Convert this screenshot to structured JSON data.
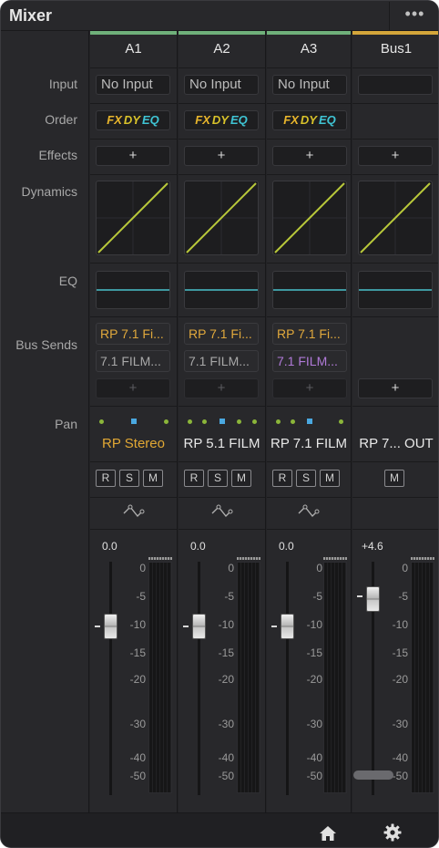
{
  "window": {
    "title": "Mixer",
    "menu_icon": "more-dots-icon"
  },
  "row_labels": {
    "input": "Input",
    "order": "Order",
    "effects": "Effects",
    "dynamics": "Dynamics",
    "eq": "EQ",
    "bus_sends": "Bus Sends",
    "pan": "Pan"
  },
  "strips": [
    {
      "name": "A1",
      "color": "#6fb07a",
      "input": "No Input",
      "order": [
        "FX",
        "DY",
        "EQ"
      ],
      "effects_add": "+",
      "sends": [
        "RP 7.1 Fi...",
        "7.1 FILM..."
      ],
      "send_add": "+",
      "output": "RP Stereo",
      "output_color": "#e2a834",
      "rsm": [
        "R",
        "S",
        "M"
      ],
      "fader_db": "0.0"
    },
    {
      "name": "A2",
      "color": "#6fb07a",
      "input": "No Input",
      "order": [
        "FX",
        "DY",
        "EQ"
      ],
      "effects_add": "+",
      "sends": [
        "RP 7.1 Fi...",
        "7.1 FILM..."
      ],
      "send_add": "+",
      "output": "RP 5.1 FILM",
      "output_color": "#e8e8e8",
      "rsm": [
        "R",
        "S",
        "M"
      ],
      "fader_db": "0.0"
    },
    {
      "name": "A3",
      "color": "#6fb07a",
      "input": "No Input",
      "order": [
        "FX",
        "DY",
        "EQ"
      ],
      "effects_add": "+",
      "sends": [
        "RP 7.1 Fi...",
        "7.1 FILM..."
      ],
      "send_add": "+",
      "output": "RP 7.1 FILM",
      "output_color": "#e8e8e8",
      "rsm": [
        "R",
        "S",
        "M"
      ],
      "fader_db": "0.0"
    },
    {
      "name": "Bus1",
      "color": "#d4a63a",
      "input": "",
      "effects_add": "+",
      "send_add": "+",
      "output": "RP 7... OUT",
      "output_color": "#e8e8e8",
      "rsm": [
        "M"
      ],
      "fader_db": "+4.6"
    }
  ],
  "scale": [
    "0",
    "-5",
    "-10",
    "-15",
    "-20",
    "-30",
    "-40",
    "-50"
  ],
  "colors": {
    "fx": "#e8b52c",
    "dy": "#d8c22a",
    "eq": "#3fc4d4",
    "dyn_curve": "#b8c83a",
    "eq_line": "#4ac2cc",
    "send_gold": "#e0a83c",
    "send_purple": "#b07ad8"
  },
  "footer": {
    "home_icon": "home-icon",
    "settings_icon": "gear-icon"
  }
}
